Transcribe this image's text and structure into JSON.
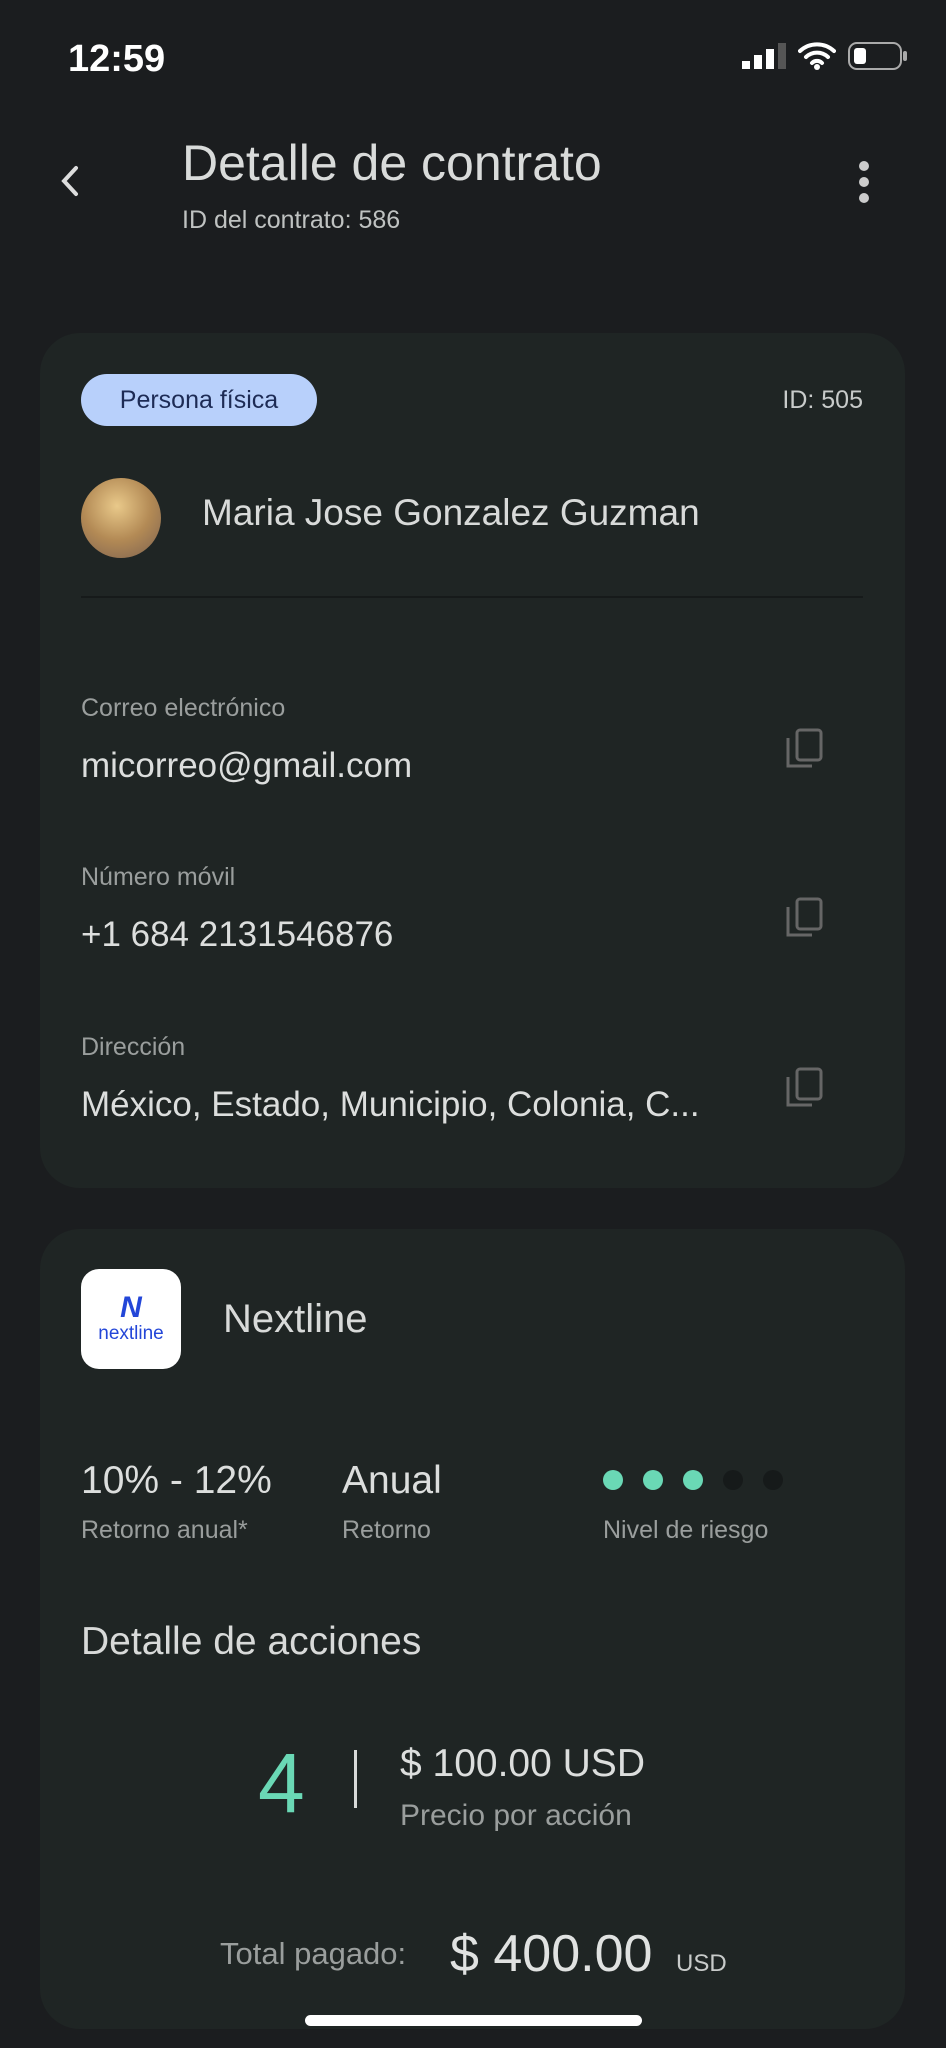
{
  "status_bar": {
    "time": "12:59"
  },
  "header": {
    "title": "Detalle de contrato",
    "subtitle": "ID del contrato: 586"
  },
  "client": {
    "badge": "Persona física",
    "id": "ID: 505",
    "name": "Maria Jose Gonzalez Guzman",
    "fields": [
      {
        "label": "Correo electrónico",
        "value": "micorreo@gmail.com"
      },
      {
        "label": "Número móvil",
        "value": "+1 684 2131546876"
      },
      {
        "label": "Dirección",
        "value": "México, Estado, Municipio, Colonia, C..."
      }
    ]
  },
  "company": {
    "name": "Nextline",
    "logo_text": "nextline",
    "stats": [
      {
        "value": "10% - 12%",
        "label": "Retorno anual*"
      },
      {
        "value": "Anual",
        "label": "Retorno"
      }
    ],
    "risk": {
      "label": "Nivel de riesgo",
      "level": 3,
      "max": 5
    },
    "colors": {
      "accent": "#6ad8b5",
      "inactive": "#161a1a"
    }
  },
  "shares": {
    "title": "Detalle de acciones",
    "count": "4",
    "price": "$ 100.00 USD",
    "price_label": "Precio por acción",
    "total_label": "Total pagado:",
    "total": "$ 400.00",
    "currency": "USD"
  }
}
